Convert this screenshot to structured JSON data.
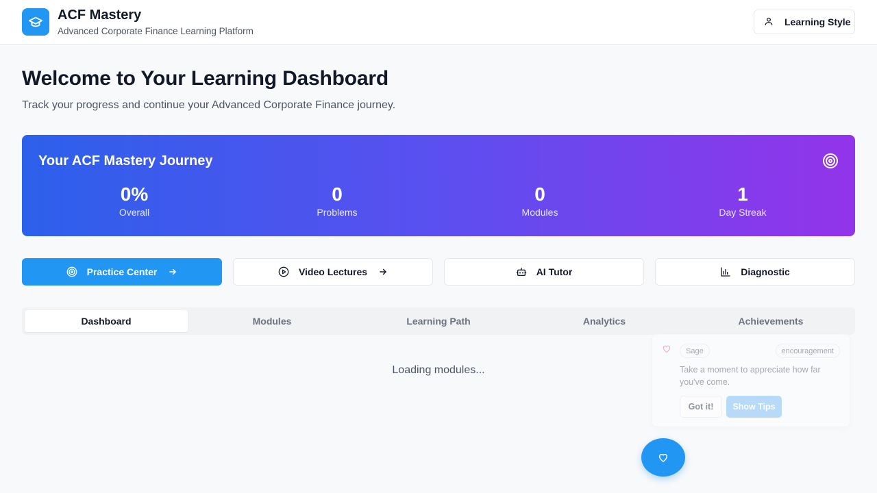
{
  "header": {
    "title": "ACF Mastery",
    "subtitle": "Advanced Corporate Finance Learning Platform",
    "learning_style_label": "Learning Style",
    "logo_icon": "graduation-cap-icon",
    "accent_color": "#2196f3"
  },
  "welcome": {
    "title": "Welcome to Your Learning Dashboard",
    "subtitle": "Track your progress and continue your Advanced Corporate Finance journey."
  },
  "journey": {
    "title": "Your ACF Mastery Journey",
    "icon": "target-icon",
    "gradient": [
      "#2c60eb",
      "#9334ea"
    ],
    "stats": [
      {
        "value": "0%",
        "label": "Overall"
      },
      {
        "value": "0",
        "label": "Problems"
      },
      {
        "value": "0",
        "label": "Modules"
      },
      {
        "value": "1",
        "label": "Day Streak"
      }
    ]
  },
  "actions": [
    {
      "label": "Practice Center",
      "icon": "target-icon",
      "arrow": true,
      "primary": true
    },
    {
      "label": "Video Lectures",
      "icon": "play-circle-icon",
      "arrow": true,
      "primary": false
    },
    {
      "label": "AI Tutor",
      "icon": "bot-icon",
      "arrow": false,
      "primary": false
    },
    {
      "label": "Diagnostic",
      "icon": "bar-chart-icon",
      "arrow": false,
      "primary": false
    }
  ],
  "tabs": [
    {
      "label": "Dashboard",
      "active": true
    },
    {
      "label": "Modules",
      "active": false
    },
    {
      "label": "Learning Path",
      "active": false
    },
    {
      "label": "Analytics",
      "active": false
    },
    {
      "label": "Achievements",
      "active": false
    }
  ],
  "main": {
    "loading_text": "Loading modules..."
  },
  "companion": {
    "name": "Sage",
    "mood": "encouragement",
    "message": "Take a moment to appreciate how far you've come.",
    "got_it_label": "Got it!",
    "show_tips_label": "Show Tips",
    "icon": "heart-icon"
  },
  "fab": {
    "icon": "heart-icon"
  }
}
